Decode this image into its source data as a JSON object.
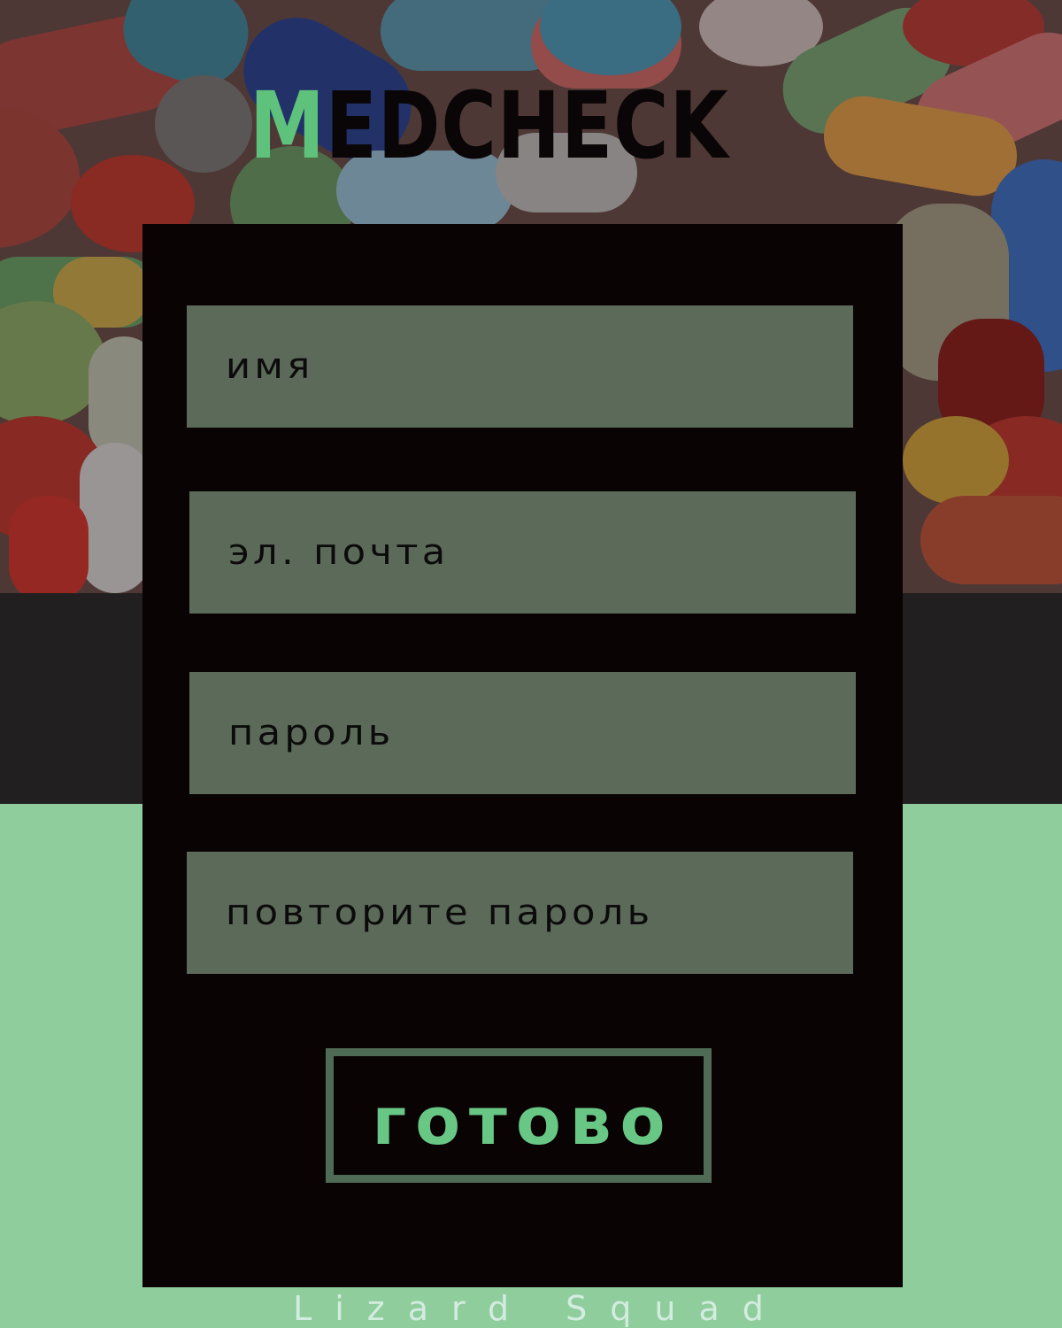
{
  "app": {
    "logo_first_letter": "M",
    "logo_rest": "EDCHECK",
    "brand_color": "#5ec27c"
  },
  "form": {
    "fields": [
      {
        "placeholder": "имя"
      },
      {
        "placeholder": "эл. почта"
      },
      {
        "placeholder": "пароль"
      },
      {
        "placeholder": "повторите пароль"
      }
    ],
    "submit_label": "готово"
  },
  "footer": {
    "text": "Lizard Squad"
  },
  "colors": {
    "card": "#0a0304",
    "field": "#5c6a5a",
    "accent_green": "#8fcd9d",
    "dark_band": "#221f20"
  }
}
